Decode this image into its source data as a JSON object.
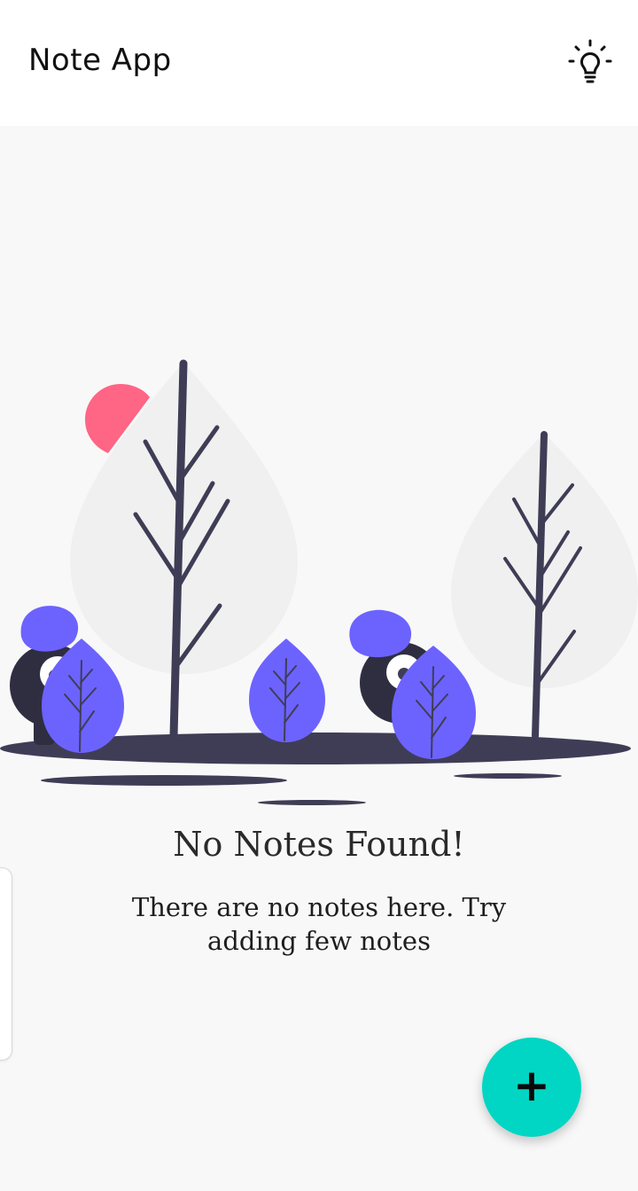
{
  "app_bar": {
    "title": "Note App",
    "theme_toggle_icon": "lightbulb-icon"
  },
  "empty_state": {
    "title": "No Notes Found!",
    "message": "There are no notes here. Try adding few notes"
  },
  "fab": {
    "icon": "plus-icon",
    "label": "+"
  },
  "colors": {
    "fab": "#00d6c3",
    "accent_purple": "#6c63ff",
    "sun": "#ff6584",
    "dark": "#3f3d56",
    "app_bar_background": "#ffffff",
    "background": "#f8f8f8"
  }
}
